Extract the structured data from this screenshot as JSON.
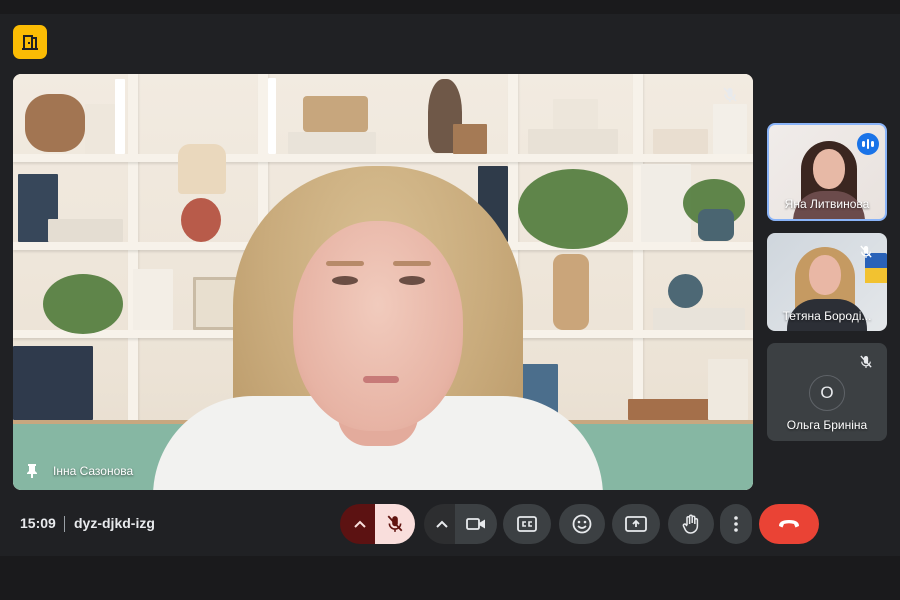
{
  "window": {
    "logo_icon": "door-icon",
    "accent_color": "#fbbc04"
  },
  "main_tile": {
    "participant_name": "Інна Сазонова",
    "muted": true,
    "pinned": true
  },
  "side_tiles": [
    {
      "name": "Яна Литвинова",
      "speaking": true,
      "muted": false
    },
    {
      "name": "Тетяна Бороді...",
      "speaking": false,
      "muted": true
    },
    {
      "name": "Ольга Бриніна",
      "avatar_letter": "О",
      "speaking": false,
      "muted": true
    }
  ],
  "footer": {
    "time": "15:09",
    "meeting_code": "dyz-djkd-izg"
  },
  "controls": {
    "mic_options_icon": "chevron-up-icon",
    "mic_icon": "mic-off-icon",
    "cam_options_icon": "chevron-up-icon",
    "camera_icon": "camera-icon",
    "captions_icon": "closed-captions-icon",
    "reactions_icon": "emoji-icon",
    "present_icon": "present-screen-icon",
    "raise_hand_icon": "hand-icon",
    "more_icon": "more-vert-icon",
    "hangup_icon": "call-end-icon",
    "hangup_color": "#ea4335",
    "mic_off_color": "#f9dedc",
    "speaking_color": "#1a73e8"
  }
}
